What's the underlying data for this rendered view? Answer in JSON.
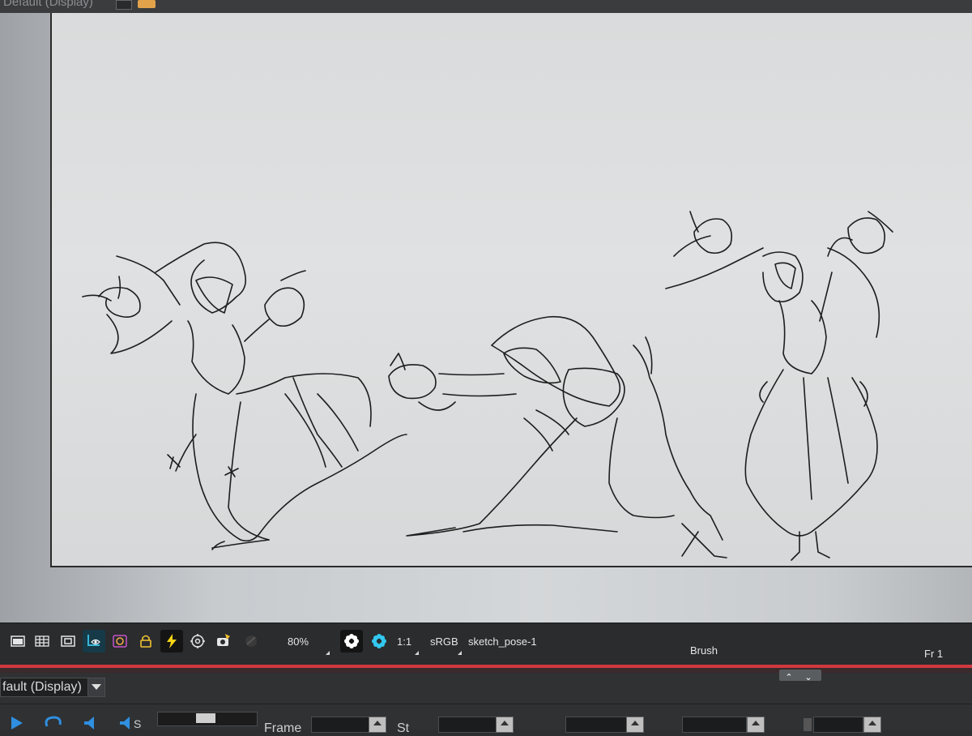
{
  "top_panel": {
    "display_label": "Default (Display)"
  },
  "status_bar": {
    "zoom": "80%",
    "aspect": "1:1",
    "color_space": "sRGB",
    "drawing_name": "sketch_pose-1",
    "tool": "Brush",
    "frame": "Fr 1",
    "icons": [
      "window-icon",
      "grid-icon",
      "safe-area-icon",
      "onion-camera-icon",
      "onion-skin-icon",
      "lock-icon",
      "lightning-icon",
      "target-icon",
      "camera-icon",
      "dark-icon",
      "flower-white-icon",
      "flower-blue-icon"
    ]
  },
  "bottom_panel": {
    "display_dropdown": "fault (Display)",
    "frame_label": "Frame",
    "start_label": "St"
  },
  "colors": {
    "accent": "#d0393e",
    "active_tool_bg": "#163a48",
    "canvas": "#dcdedf"
  }
}
